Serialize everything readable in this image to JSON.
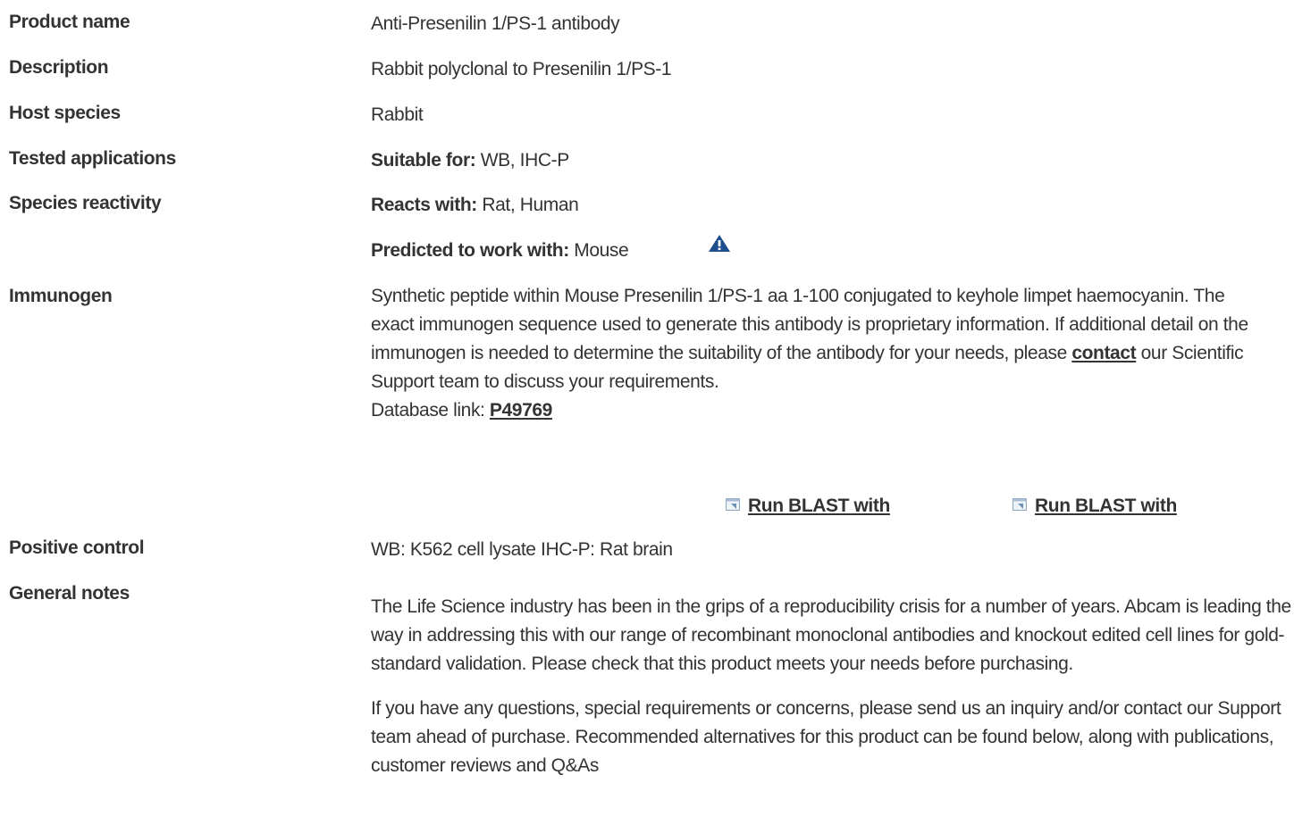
{
  "fields": {
    "product_name": {
      "label": "Product name",
      "value": "Anti-Presenilin 1/PS-1 antibody"
    },
    "description": {
      "label": "Description",
      "value": "Rabbit polyclonal to Presenilin 1/PS-1"
    },
    "host_species": {
      "label": "Host species",
      "value": "Rabbit"
    },
    "tested_applications": {
      "label": "Tested applications",
      "prefix": "Suitable for:",
      "value": "WB, IHC-P"
    },
    "species_reactivity": {
      "label": "Species reactivity",
      "reacts_prefix": "Reacts with:",
      "reacts_value": "Rat, Human",
      "predicted_prefix": "Predicted to work with:",
      "predicted_value": "Mouse",
      "warning_icon": "warning-triangle-icon"
    },
    "immunogen": {
      "label": "Immunogen",
      "text_before_link": "Synthetic peptide within Mouse Presenilin 1/PS-1 aa 1-100 conjugated to keyhole limpet haemocyanin. The exact immunogen sequence used to generate this antibody is proprietary information. If additional detail on the immunogen is needed to determine the suitability of the antibody for your needs, please ",
      "link_text": "contact",
      "text_after_link": " our Scientific Support team to discuss your requirements.",
      "database_prefix": "Database link: ",
      "database_id": "P49769",
      "blast_1": "Run BLAST with",
      "blast_2": "Run BLAST with",
      "blast_icon": "external-link-icon"
    },
    "positive_control": {
      "label": "Positive control",
      "value": "WB: K562 cell lysate IHC-P: Rat brain"
    },
    "general_notes": {
      "label": "General notes",
      "paragraph_1": "The Life Science industry has been in the grips of a reproducibility crisis for a number of years. Abcam is leading the way in addressing this with our range of recombinant monoclonal antibodies and knockout edited cell lines for gold-standard validation. Please check that this product meets your needs before purchasing.",
      "paragraph_2": "If you have any questions, special requirements or concerns, please send us an inquiry and/or contact our Support team ahead of purchase. Recommended alternatives for this product can be found below, along with publications, customer reviews and Q&As"
    }
  },
  "colors": {
    "text": "#333333",
    "warning_icon": "#1f4e8c"
  }
}
